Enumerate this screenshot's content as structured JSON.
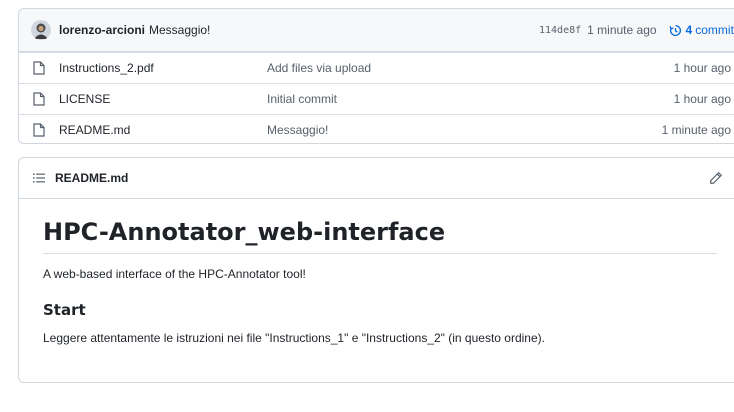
{
  "latest_commit": {
    "author": "lorenzo-arcioni",
    "message": "Messaggio!",
    "sha": "114de8f",
    "time": "1 minute ago",
    "commit_count": "4",
    "commits_label": "commits"
  },
  "files": [
    {
      "name": "Instructions_2.pdf",
      "message": "Add files via upload",
      "age": "1 hour ago"
    },
    {
      "name": "LICENSE",
      "message": "Initial commit",
      "age": "1 hour ago"
    },
    {
      "name": "README.md",
      "message": "Messaggio!",
      "age": "1 minute ago"
    }
  ],
  "readme": {
    "header": "README.md",
    "title": "HPC-Annotator_web-interface",
    "intro": "A web-based interface of the HPC-Annotator tool!",
    "section_heading": "Start",
    "section_text": "Leggere attentamente le istruzioni nei file \"Instructions_1\" e \"Instructions_2\" (in questo ordine)."
  },
  "colors": {
    "link": "#0969da",
    "muted": "#57606a",
    "border": "#d0d7de",
    "header_bg": "#f6f8fa"
  },
  "icons": {
    "file": "file-icon",
    "history": "history-icon",
    "list": "list-unordered-icon",
    "edit": "pencil-icon"
  }
}
